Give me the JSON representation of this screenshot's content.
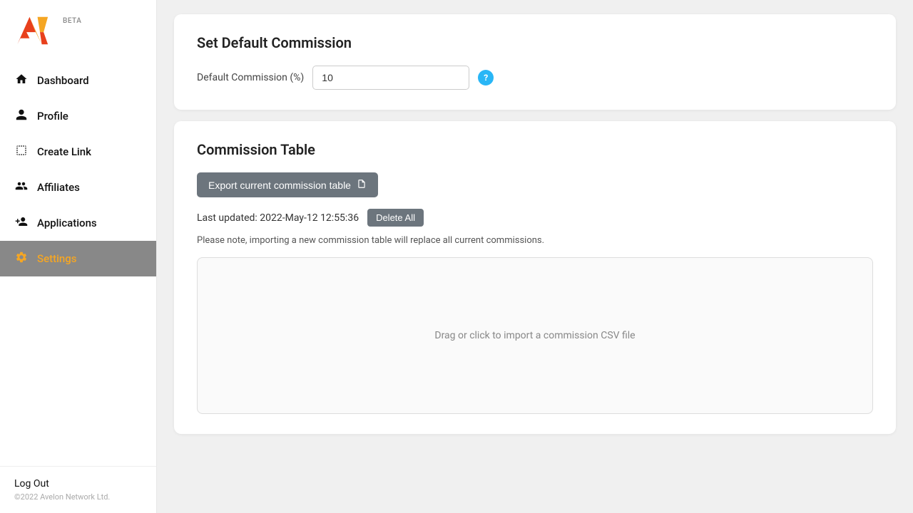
{
  "sidebar": {
    "logo": {
      "beta_label": "BETA"
    },
    "nav_items": [
      {
        "id": "dashboard",
        "label": "Dashboard",
        "icon": "house",
        "active": false
      },
      {
        "id": "profile",
        "label": "Profile",
        "icon": "person",
        "active": false
      },
      {
        "id": "create-link",
        "label": "Create Link",
        "icon": "link",
        "active": false
      },
      {
        "id": "affiliates",
        "label": "Affiliates",
        "icon": "people",
        "active": false
      },
      {
        "id": "applications",
        "label": "Applications",
        "icon": "person-add",
        "active": false
      },
      {
        "id": "settings",
        "label": "Settings",
        "icon": "gear",
        "active": true
      }
    ],
    "logout_label": "Log Out",
    "copyright": "©2022 Avelon Network Ltd."
  },
  "main": {
    "section_commission": {
      "title": "Set Default Commission",
      "label": "Default Commission (%)",
      "input_value": "10",
      "input_placeholder": "10"
    },
    "section_table": {
      "title": "Commission Table",
      "export_btn_label": "Export current commission table",
      "last_updated_label": "Last updated: 2022-May-12 12:55:36",
      "delete_all_label": "Delete All",
      "note": "Please note, importing a new commission table will replace all current commissions.",
      "drop_zone_text": "Drag or click to import a commission CSV file"
    }
  }
}
